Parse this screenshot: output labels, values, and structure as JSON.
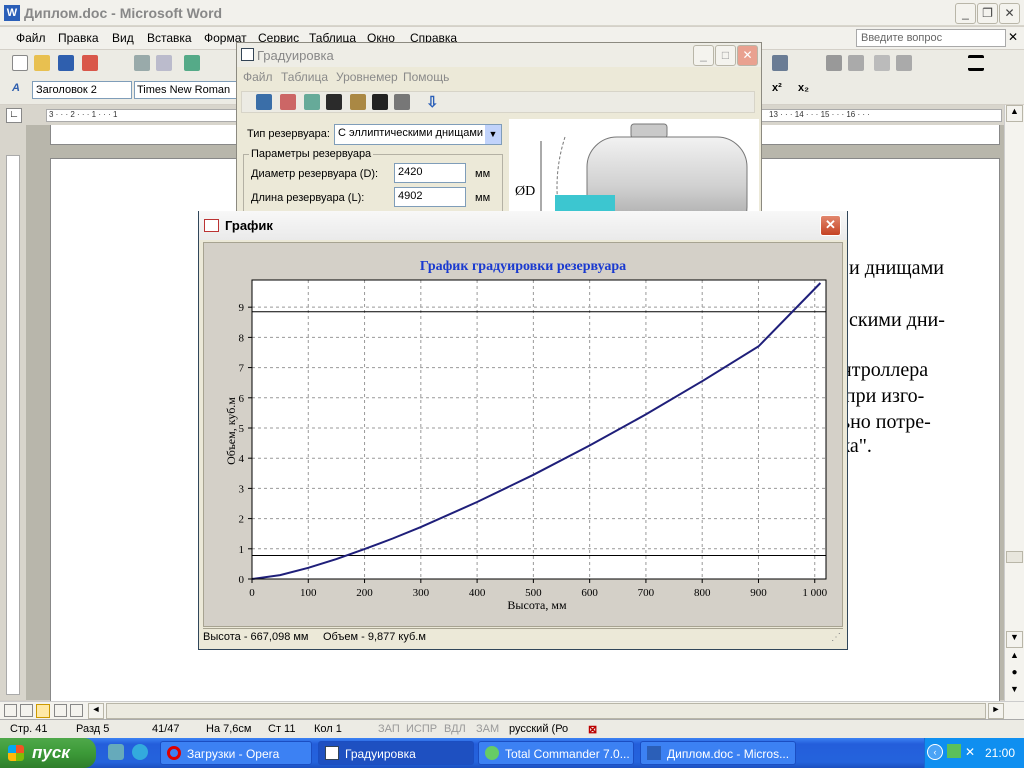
{
  "word": {
    "title": "Диплом.doc - Microsoft Word",
    "menu": [
      "Файл",
      "Правка",
      "Вид",
      "Вставка",
      "Формат",
      "Сервис",
      "Таблица",
      "Окно",
      "Справка"
    ],
    "ask_placeholder": "Введите вопрос",
    "style_box": "Заголовок 2",
    "font_box": "Times New Roman",
    "ruler_left": "3 · · · 2 · · · 1 · · · 1",
    "ruler_right": "13 · · · 14 · · · 15 · · · 16 · · ·",
    "doc_lines": [
      "и днищами",
      "скими дни-",
      "онтроллера",
      "а при изго-",
      "льно потре-",
      "вка\"."
    ],
    "status": {
      "page": "Стр.  41",
      "section": "Разд  5",
      "pages": "41/47",
      "at": "На 7,6см",
      "line": "Ст  11",
      "col": "Кол  1",
      "rec": "ЗАП",
      "trk": "ИСПР",
      "ext": "ВДЛ",
      "ovr": "ЗАМ",
      "lang": "русский (Ро"
    }
  },
  "taskbar": {
    "start": "пуск",
    "tasks": [
      "Загрузки - Opera",
      "Градуировка",
      "Total Commander 7.0...",
      "Диплом.doc - Micros..."
    ],
    "clock": "21:00"
  },
  "grad": {
    "title": "Градуировка",
    "menu": [
      "Файл",
      "Таблица",
      "Уровнемер",
      "Помощь"
    ],
    "tank_type_label": "Тип резервуара:",
    "tank_type_value": "С эллиптическими днищами",
    "params_group": "Параметры резервуара",
    "diameter_label": "Диаметр резервуара (D):",
    "diameter_value": "2420",
    "diameter_unit": "мм",
    "length_label": "Длина резервуара (L):",
    "length_value": "4902",
    "length_unit": "мм",
    "diagram_label": "ØD"
  },
  "graph": {
    "title": "График",
    "status_height": "Высота - 667,098 мм",
    "status_volume": "Объем - 9,877 куб.м"
  },
  "chart_data": {
    "type": "line",
    "title": "График градуировки резервуара",
    "xlabel": "Высота, мм",
    "ylabel": "Объем, куб.м",
    "xlim": [
      0,
      1020
    ],
    "ylim": [
      0,
      9.9
    ],
    "x_ticks": [
      "0",
      "100",
      "200",
      "300",
      "400",
      "500",
      "600",
      "700",
      "800",
      "900",
      "1 000"
    ],
    "y_ticks": [
      "0",
      "1",
      "2",
      "3",
      "4",
      "5",
      "6",
      "7",
      "8",
      "9"
    ],
    "grid": true,
    "series": [
      {
        "x": [
          0,
          50,
          100,
          150,
          200,
          250,
          300,
          400,
          500,
          600,
          700,
          800,
          900,
          1010
        ],
        "values": [
          0,
          0.13,
          0.37,
          0.66,
          0.99,
          1.34,
          1.72,
          2.55,
          3.45,
          4.42,
          5.45,
          6.55,
          7.7,
          9.8
        ],
        "color": "#1f1f7a"
      }
    ],
    "reference_lines": [
      0.78,
      8.85
    ]
  }
}
